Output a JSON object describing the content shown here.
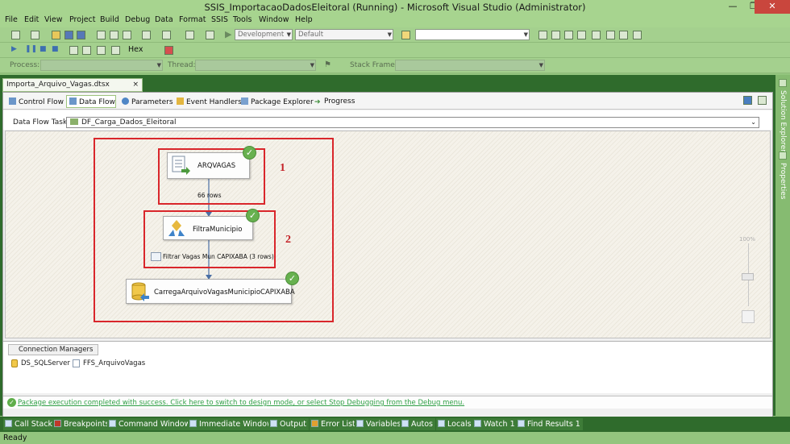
{
  "window": {
    "title": "SSIS_ImportacaoDadosEleitoral (Running) - Microsoft Visual Studio (Administrator)",
    "minimize": "—",
    "restore": "❐",
    "close": "✕"
  },
  "menu": [
    "File",
    "Edit",
    "View",
    "Project",
    "Build",
    "Debug",
    "Data",
    "Format",
    "SSIS",
    "Tools",
    "Window",
    "Help"
  ],
  "toolbar": {
    "config_combo": "Development",
    "platform_combo": "Default",
    "hex_label": "Hex",
    "process_label": "Process:",
    "thread_label": "Thread:",
    "stackframe_label": "Stack Frame:"
  },
  "document_tab": {
    "label": "Importa_Arquivo_Vagas.dtsx [Design]",
    "close": "×"
  },
  "designer_tabs": [
    "Control Flow",
    "Data Flow",
    "Parameters",
    "Event Handlers",
    "Package Explorer",
    "Progress"
  ],
  "data_flow_task": {
    "label": "Data Flow Task:",
    "value": "DF_Carga_Dados_Eleitoral"
  },
  "components": {
    "source": {
      "name": "ARQVAGAS",
      "status": "✓"
    },
    "transform": {
      "name": "FiltraMunicipio",
      "status": "✓"
    },
    "destination": {
      "name": "CarregaArquivoVagasMunicipioCAPIXABA",
      "status": "✓"
    }
  },
  "flows": {
    "first": "66 rows",
    "second": "Filtrar Vagas Mun CAPIXABA (3 rows)"
  },
  "annotations": [
    "1",
    "2"
  ],
  "zoom": {
    "label": "100%"
  },
  "connection_managers": {
    "tab_label": "Connection Managers",
    "items": [
      "DS_SQLServer",
      "FFS_ArquivoVagas"
    ]
  },
  "message": "Package execution completed with success. Click here to switch to design mode, or select Stop Debugging from the Debug menu.",
  "side_panels": [
    "Solution Explorer",
    "Properties"
  ],
  "bottom_tabs": [
    "Call Stack",
    "Breakpoints",
    "Command Window",
    "Immediate Window",
    "Output",
    "Error List",
    "Variables",
    "Autos",
    "Locals",
    "Watch 1",
    "Find Results 1"
  ],
  "status": "Ready",
  "colors": {
    "chrome_green": "#a7d48f",
    "doc_dark_green": "#2f6b2c",
    "annotation_red": "#d9262b",
    "success_green": "#67b14f"
  }
}
